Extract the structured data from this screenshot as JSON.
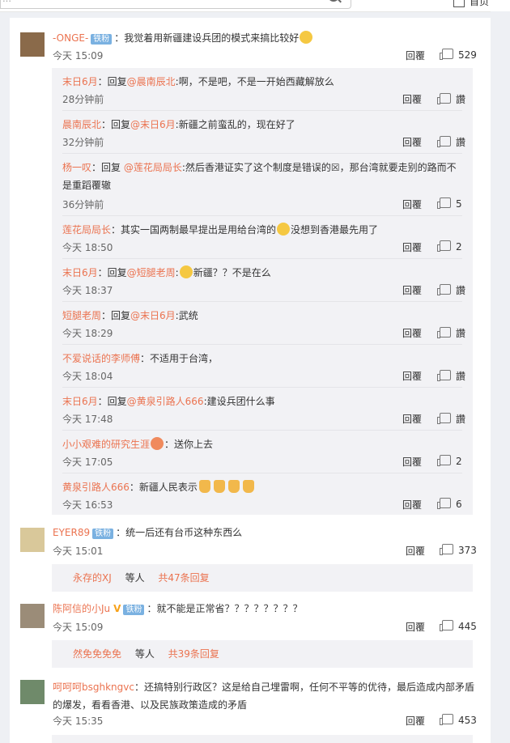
{
  "topbar": {
    "search_text": "…",
    "right_label": "首页"
  },
  "comments": [
    {
      "user": "-ONGE-",
      "badge": "铁粉",
      "text": "：我觉着用新疆建设兵团的模式来搞比较好",
      "time": "今天 15:09",
      "reply": "回覆",
      "likes": "529",
      "avatar_color": "#8a6a4a"
    },
    {
      "user": "EYER89",
      "badge": "铁粉",
      "text": "：统一后还有台币这种东西么",
      "time": "今天 15:01",
      "reply": "回覆",
      "likes": "373",
      "avatar_color": "#d9c89a",
      "more_user": "永存的XJ",
      "more_mid": " 等人 ",
      "more_count": "共47条回复"
    },
    {
      "user": "陈阿信的小Ju",
      "badge": "铁粉",
      "text": "：就不能是正常省？？？？？？？？",
      "time": "今天 15:09",
      "reply": "回覆",
      "likes": "445",
      "avatar_color": "#9b8c78",
      "more_user": "然免免免免",
      "more_mid": " 等人 ",
      "more_count": "共39条回复"
    },
    {
      "user": "呵呵呵bsghkngvc",
      "text": "：还搞特别行政区？这是给自己埋雷啊，任何不平等的优待，最后造成内部矛盾",
      "text2": "的爆发，看看香港、以及民族政策造成的矛盾",
      "time": "今天 15:35",
      "reply": "回覆",
      "likes": "453",
      "avatar_color": "#6f8a6a"
    }
  ],
  "subreplies": [
    {
      "user": "末日6月",
      "mid": "：回复",
      "at": "@晨南辰北",
      "text": ":啊，不是吧，不是一开始西藏解放么",
      "time": "28分钟前",
      "reply": "回覆",
      "like": "讚"
    },
    {
      "user": "晨南辰北",
      "mid": "：回复",
      "at": "@末日6月",
      "text": ":新疆之前蛮乱的，现在好了",
      "time": "32分钟前",
      "reply": "回覆",
      "like": "讚"
    },
    {
      "user": "杨一叹",
      "mid": "：回复 ",
      "at": "@莲花局局长",
      "text": ":然后香港证实了这个制度是错误的☒，那台湾就要走别的路而不",
      "text2": "是重蹈覆辙",
      "time": "36分钟前",
      "reply": "回覆",
      "like": "5"
    },
    {
      "user": "莲花局局长",
      "mid": "：其实一国两制最早提出是用给台湾的",
      "at": "",
      "text": "没想到香港最先用了",
      "time": "今天 18:50",
      "reply": "回覆",
      "like": "2"
    },
    {
      "user": "末日6月",
      "mid": "：回复",
      "at": "@短腿老周",
      "text": "新疆？？不是在么",
      "time": "今天 18:37",
      "reply": "回覆",
      "like": "讚"
    },
    {
      "user": "短腿老周",
      "mid": "：回复",
      "at": "@末日6月",
      "text": ":武统",
      "time": "今天 18:29",
      "reply": "回覆",
      "like": "讚"
    },
    {
      "user": "不爱说话的李师傅",
      "mid": "：不适用于台湾，",
      "at": "",
      "text": "",
      "time": "今天 18:04",
      "reply": "回覆",
      "like": "讚"
    },
    {
      "user": "末日6月",
      "mid": "：回复",
      "at": "@黄泉引路人666",
      "text": ":建设兵团什么事",
      "time": "今天 17:48",
      "reply": "回覆",
      "like": "讚"
    },
    {
      "user": "小小艰难的研究生涯",
      "mid": "",
      "at": "",
      "text": "：送你上去",
      "time": "今天 17:05",
      "reply": "回覆",
      "like": "2"
    },
    {
      "user": "黄泉引路人666",
      "mid": "：新疆人民表示",
      "at": "",
      "text": "",
      "time": "今天 16:53",
      "reply": "回覆",
      "like": "6"
    }
  ]
}
